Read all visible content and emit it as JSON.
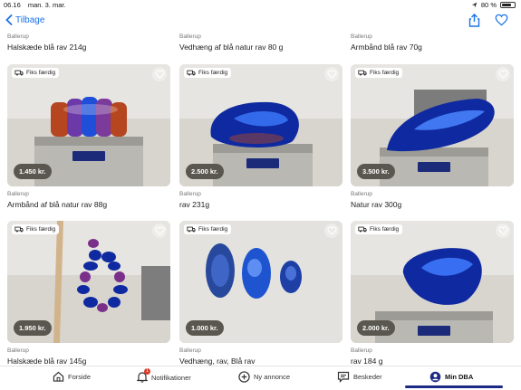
{
  "status_bar": {
    "time": "06.16",
    "date": "man. 3. mar.",
    "battery_text": "80 %",
    "battery_level": 0.8
  },
  "nav": {
    "back_label": "Tilbage"
  },
  "top_row": [
    {
      "location": "Ballerup",
      "title": "Halskæde blå rav 214g"
    },
    {
      "location": "Ballerup",
      "title": "Vedhæng af blå natur rav 80 g"
    },
    {
      "location": "Ballerup",
      "title": "Armbånd blå rav 70g"
    }
  ],
  "listings": [
    {
      "badge": "Fiks færdig",
      "price": "1.450 kr.",
      "location": "Ballerup",
      "title": "Armbånd af blå natur rav 88g",
      "scale_reading": "88.0"
    },
    {
      "badge": "Fiks færdig",
      "price": "2.500 kr.",
      "location": "Ballerup",
      "title": "rav 231g",
      "scale_reading": "231.6"
    },
    {
      "badge": "Fiks færdig",
      "price": "3.500 kr.",
      "location": "Ballerup",
      "title": "Natur rav 300g",
      "scale_reading": ""
    },
    {
      "badge": "Fiks færdig",
      "price": "1.950 kr.",
      "location": "Ballerup",
      "title": "Halskæde blå rav 145g",
      "scale_reading": ""
    },
    {
      "badge": "Fiks færdig",
      "price": "1.000 kr.",
      "location": "Ballerup",
      "title": "Vedhæng, rav, Blå rav",
      "scale_reading": ""
    },
    {
      "badge": "Fiks færdig",
      "price": "2.000 kr.",
      "location": "Ballerup",
      "title": "rav 184 g",
      "scale_reading": "184.5"
    }
  ],
  "tab_bar": {
    "items": [
      {
        "label": "Forside",
        "icon": "home-icon"
      },
      {
        "label": "Notifikationer",
        "icon": "bell-icon",
        "badge": "1"
      },
      {
        "label": "Ny annonce",
        "icon": "plus-circle-icon"
      },
      {
        "label": "Beskeder",
        "icon": "chat-icon"
      },
      {
        "label": "Min DBA",
        "icon": "user-icon"
      }
    ],
    "active": "Min DBA"
  },
  "colors": {
    "accent": "#1a73e8",
    "price_pill": "#5a5750",
    "active_tab": "#1c2a86",
    "notification": "#d83a2a"
  }
}
